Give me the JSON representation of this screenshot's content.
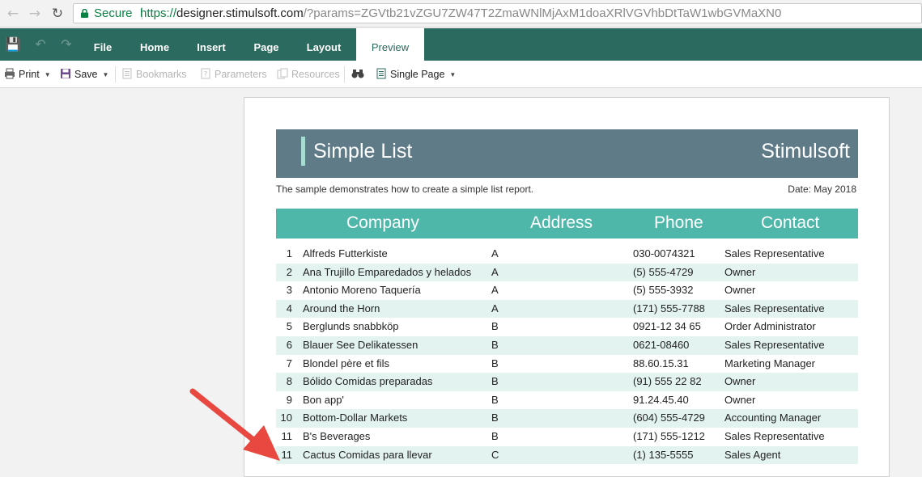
{
  "browser": {
    "secure_label": "Secure",
    "url_scheme": "https://",
    "url_host": "designer.stimulsoft.com",
    "url_rest": "/?params=ZGVtb21vZGU7ZW47T2ZmaWNlMjAxM1doaXRlVGVhbDtTaW1wbGVMaXN0"
  },
  "ribbon": {
    "tabs": [
      "File",
      "Home",
      "Insert",
      "Page",
      "Layout",
      "Preview"
    ],
    "active_tab": "Preview",
    "accent_color": "#2b6a5e"
  },
  "toolbar": {
    "print_label": "Print",
    "save_label": "Save",
    "bookmarks_label": "Bookmarks",
    "parameters_label": "Parameters",
    "resources_label": "Resources",
    "view_mode_label": "Single Page"
  },
  "report": {
    "title": "Simple List",
    "brand": "Stimulsoft",
    "subtitle": "The sample demonstrates how to create a simple list report.",
    "date": "Date: May 2018",
    "columns": [
      "Company",
      "Address",
      "Phone",
      "Contact"
    ],
    "rows": [
      {
        "num": "1",
        "company": "Alfreds Futterkiste",
        "address": "A",
        "phone": "030-0074321",
        "contact": "Sales Representative"
      },
      {
        "num": "2",
        "company": "Ana Trujillo Emparedados y helados",
        "address": "A",
        "phone": "(5) 555-4729",
        "contact": "Owner"
      },
      {
        "num": "3",
        "company": "Antonio Moreno Taquería",
        "address": "A",
        "phone": "(5) 555-3932",
        "contact": "Owner"
      },
      {
        "num": "4",
        "company": "Around the Horn",
        "address": "A",
        "phone": "(171) 555-7788",
        "contact": "Sales Representative"
      },
      {
        "num": "5",
        "company": "Berglunds snabbköp",
        "address": "B",
        "phone": "0921-12 34 65",
        "contact": "Order Administrator"
      },
      {
        "num": "6",
        "company": "Blauer See Delikatessen",
        "address": "B",
        "phone": "0621-08460",
        "contact": "Sales Representative"
      },
      {
        "num": "7",
        "company": "Blondel père et fils",
        "address": "B",
        "phone": "88.60.15.31",
        "contact": "Marketing Manager"
      },
      {
        "num": "8",
        "company": "Bólido Comidas preparadas",
        "address": "B",
        "phone": "(91) 555 22 82",
        "contact": "Owner"
      },
      {
        "num": "9",
        "company": "Bon app'",
        "address": "B",
        "phone": "91.24.45.40",
        "contact": "Owner"
      },
      {
        "num": "10",
        "company": "Bottom-Dollar Markets",
        "address": "B",
        "phone": "(604) 555-4729",
        "contact": "Accounting Manager"
      },
      {
        "num": "11",
        "company": "B's Beverages",
        "address": "B",
        "phone": "(171) 555-1212",
        "contact": "Sales Representative"
      },
      {
        "num": "11",
        "company": "Cactus Comidas para llevar",
        "address": "C",
        "phone": "(1) 135-5555",
        "contact": "Sales Agent"
      }
    ]
  }
}
